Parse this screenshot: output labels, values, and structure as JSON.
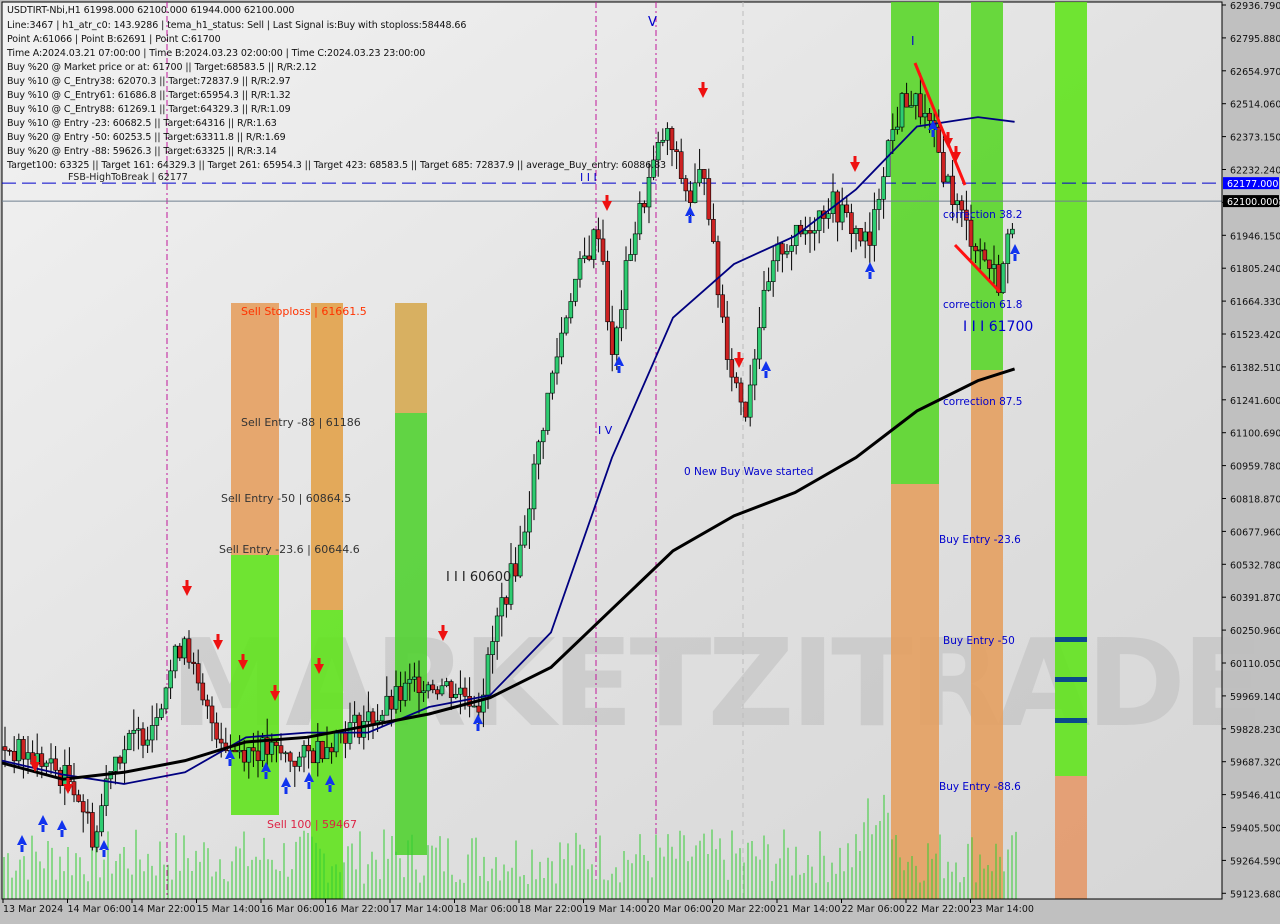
{
  "header": {
    "symbol_line": "USDTIRT-Nbi,H1  61998.000 62100.000 61944.000 62100.000",
    "lines": [
      "Line:3467 | h1_atr_c0: 143.9286 | tema_h1_status: Sell | Last Signal is:Buy with stoploss:58448.66",
      "Point A:61066 | Point B:62691 | Point C:61700",
      "Time A:2024.03.21 07:00:00 | Time B:2024.03.23 02:00:00 | Time C:2024.03.23 23:00:00",
      "Buy %20 @ Market price or at: 61700 || Target:68583.5 || R/R:2.12",
      "Buy %10 @ C_Entry38: 62070.3 || Target:72837.9 || R/R:2.97",
      "Buy %10 @ C_Entry61: 61686.8 || Target:65954.3 || R/R:1.32",
      "Buy %10 @ C_Entry88: 61269.1 || Target:64329.3 || R/R:1.09",
      "Buy %10 @ Entry -23: 60682.5 || Target:64316 || R/R:1.63",
      "Buy %20 @ Entry -50: 60253.5 || Target:63311.8 || R/R:1.69",
      "Buy %20 @ Entry -88: 59626.3 || Target:63325 || R/R:3.14",
      "Target100: 63325 || Target 161: 64329.3 || Target 261: 65954.3 || Target 423: 68583.5 || Target 685: 72837.9 || average_Buy_entry: 60886.83"
    ]
  },
  "watermark": "MARKETZITRADE",
  "chart_data": {
    "type": "candlestick",
    "title": "USDTIRT-Nbi,H1",
    "ylim": [
      59123.68,
      62936.79
    ],
    "y_ticks": [
      "62936.790",
      "62795.880",
      "62654.970",
      "62514.060",
      "62373.150",
      "62232.240",
      "62091.330",
      "61946.150",
      "61805.240",
      "61664.330",
      "61523.420",
      "61382.510",
      "61241.600",
      "61100.690",
      "60959.780",
      "60818.870",
      "60677.960",
      "60532.780",
      "60391.870",
      "60250.960",
      "60110.050",
      "59969.140",
      "59828.230",
      "59687.320",
      "59546.410",
      "59405.500",
      "59264.590",
      "59123.680"
    ],
    "x_ticks": [
      "13 Mar 2024",
      "14 Mar 06:00",
      "14 Mar 22:00",
      "15 Mar 14:00",
      "16 Mar 06:00",
      "16 Mar 22:00",
      "17 Mar 14:00",
      "18 Mar 06:00",
      "18 Mar 22:00",
      "19 Mar 14:00",
      "20 Mar 06:00",
      "20 Mar 22:00",
      "21 Mar 14:00",
      "22 Mar 06:00",
      "22 Mar 22:00",
      "23 Mar 14:00"
    ],
    "price_labels": [
      {
        "name": "fsb-high-to-break",
        "value": 62177.0,
        "text": "62177.000",
        "color": "#0000ff"
      },
      {
        "name": "current-price",
        "value": 62100.0,
        "text": "62100.000",
        "color": "#000000"
      }
    ],
    "horizontal_lines": [
      {
        "label": "FSB-HighToBreak | 62177",
        "value": 62177,
        "style": "dashed",
        "color": "#0000cc"
      },
      {
        "label": "",
        "value": 62100,
        "style": "solid",
        "color": "#708090"
      }
    ],
    "annotations": [
      {
        "text": "Sell Stoploss | 61661.5",
        "value": 61661.5,
        "color": "#ff3300"
      },
      {
        "text": "Sell Entry -88 | 61186",
        "value": 61186,
        "color": "#333333"
      },
      {
        "text": "Sell Entry -50 | 60864.5",
        "value": 60864.5,
        "color": "#333333"
      },
      {
        "text": "Sell Entry -23.6 | 60644.6",
        "value": 60644.6,
        "color": "#333333"
      },
      {
        "text": "Sell 100 | 59467",
        "value": 59467,
        "color": "#dd2244"
      },
      {
        "text": "I I I 60600",
        "value": 60500,
        "color": "#222222"
      },
      {
        "text": "I V",
        "value": 61120,
        "color": "#0000cc"
      },
      {
        "text": "V",
        "value": 62900,
        "color": "#0000cc"
      },
      {
        "text": "I I I",
        "value": 62170,
        "color": "#0000cc"
      },
      {
        "text": "I",
        "value": 62840,
        "color": "#0000cc"
      },
      {
        "text": "0 New Buy Wave started",
        "value": 60960,
        "color": "#0000cc"
      },
      {
        "text": "correction 38.2",
        "value": 62070,
        "color": "#0000cc"
      },
      {
        "text": "correction 61.8",
        "value": 61686.8,
        "color": "#0000cc"
      },
      {
        "text": "I I I 61700",
        "value": 61560,
        "color": "#0000cc"
      },
      {
        "text": "correction 87.5",
        "value": 61269.1,
        "color": "#0000cc"
      },
      {
        "text": "Buy Entry -23.6",
        "value": 60682.5,
        "color": "#0000cc"
      },
      {
        "text": "Buy Entry -50",
        "value": 60253.5,
        "color": "#0000cc"
      },
      {
        "text": "Buy Entry -88.6",
        "value": 59626.3,
        "color": "#0000cc"
      }
    ],
    "series": [
      {
        "name": "ma-fast",
        "color": "#000080",
        "x_frac": [
          0,
          0.05,
          0.1,
          0.15,
          0.2,
          0.25,
          0.3,
          0.35,
          0.4,
          0.45,
          0.5,
          0.55,
          0.6,
          0.65,
          0.7,
          0.75,
          0.8,
          0.83
        ],
        "values": [
          59700,
          59640,
          59600,
          59650,
          59800,
          59820,
          59820,
          59930,
          59980,
          60250,
          61000,
          61600,
          61830,
          61950,
          62150,
          62420,
          62460,
          62440
        ]
      },
      {
        "name": "ma-slow",
        "color": "#000000",
        "x_frac": [
          0,
          0.05,
          0.1,
          0.15,
          0.2,
          0.25,
          0.3,
          0.35,
          0.4,
          0.45,
          0.5,
          0.55,
          0.6,
          0.65,
          0.7,
          0.75,
          0.8,
          0.83
        ],
        "values": [
          59690,
          59620,
          59650,
          59700,
          59780,
          59800,
          59850,
          59900,
          59970,
          60100,
          60350,
          60600,
          60750,
          60850,
          61000,
          61200,
          61330,
          61380
        ]
      }
    ]
  },
  "zones": [
    {
      "name": "sell-zone-1",
      "col": 0,
      "top": 61661.5,
      "bottom": 59500,
      "color": "#e8a05a"
    },
    {
      "name": "sell-zone-2",
      "col": 1,
      "top": 61661.5,
      "bottom": 59150,
      "color": "#e0a040"
    },
    {
      "name": "sell-zone-3",
      "col": 2,
      "top": 61661.5,
      "bottom": 59300,
      "color": "#d4a850"
    },
    {
      "name": "buy-zone-1",
      "col": 3,
      "top": 62936,
      "bottom": 59123,
      "color": "#5cd62a"
    },
    {
      "name": "buy-zone-2",
      "col": 4,
      "top": 62936,
      "bottom": 59123,
      "color": "#5cd62a"
    },
    {
      "name": "buy-zone-3",
      "col": 5,
      "top": 62936,
      "bottom": 59123,
      "color": "#5cd62a"
    }
  ]
}
